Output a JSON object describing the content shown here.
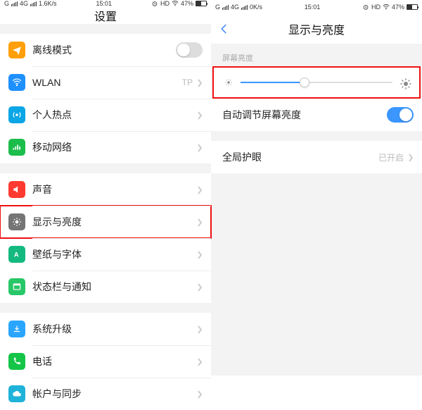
{
  "left": {
    "status": {
      "carrier": "G",
      "net": "4G",
      "speed": "1.6K/s",
      "time": "15:01",
      "hd": "HD",
      "batt": "47%"
    },
    "title": "设置",
    "rows": [
      {
        "label": "离线模式",
        "right": "",
        "switch": "off"
      },
      {
        "label": "WLAN",
        "right": "TP"
      },
      {
        "label": "个人热点",
        "right": ""
      },
      {
        "label": "移动网络",
        "right": ""
      }
    ],
    "rows2": [
      {
        "label": "声音"
      },
      {
        "label": "显示与亮度",
        "highlight": true
      },
      {
        "label": "壁纸与字体"
      },
      {
        "label": "状态栏与通知"
      }
    ],
    "rows3": [
      {
        "label": "系统升级"
      },
      {
        "label": "电话"
      },
      {
        "label": "帐户与同步"
      }
    ]
  },
  "right": {
    "status": {
      "carrier": "G",
      "net": "4G",
      "speed": "0K/s",
      "time": "15:01",
      "hd": "HD",
      "batt": "47%"
    },
    "title": "显示与亮度",
    "section_brightness": "屏幕亮度",
    "auto_label": "自动调节屏幕亮度",
    "global_eye_label": "全局护眼",
    "global_eye_value": "已开启"
  }
}
